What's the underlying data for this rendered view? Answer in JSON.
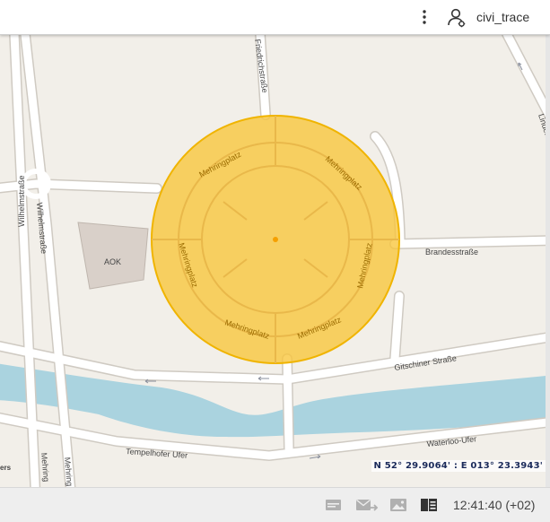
{
  "header": {
    "username": "civi_trace",
    "menu_icon": "more-vert-icon",
    "user_icon": "user-settings-icon"
  },
  "map": {
    "labels": {
      "friedrichstrasse": "Friedrichstraße",
      "mehringplatz": "Mehringplatz",
      "wilhelmstrasse": "Wilhelmstraße",
      "aok": "AOK",
      "brandesstrasse": "Brandesstraße",
      "gitschiner": "Gitschiner Straße",
      "tempelhofer": "Tempelhofer Ufer",
      "waterloo": "Waterloo-Ufer",
      "linden": "Linden",
      "mehring_small": "Mehring",
      "ers": "ers"
    },
    "coordinates": "N 52° 29.9064' : E 013° 23.3943'",
    "colors": {
      "ground": "#f2efe9",
      "road": "#ffffff",
      "road_casing": "#cfcac2",
      "water": "#aad3df",
      "circle_fill": "#f8c53a",
      "circle_stroke": "#f0b400",
      "building": "#d9d0c9"
    }
  },
  "footer": {
    "time": "12:41:40 (+02)",
    "icons": [
      "message-icon",
      "forward-mail-icon",
      "image-icon",
      "map-book-icon"
    ]
  }
}
